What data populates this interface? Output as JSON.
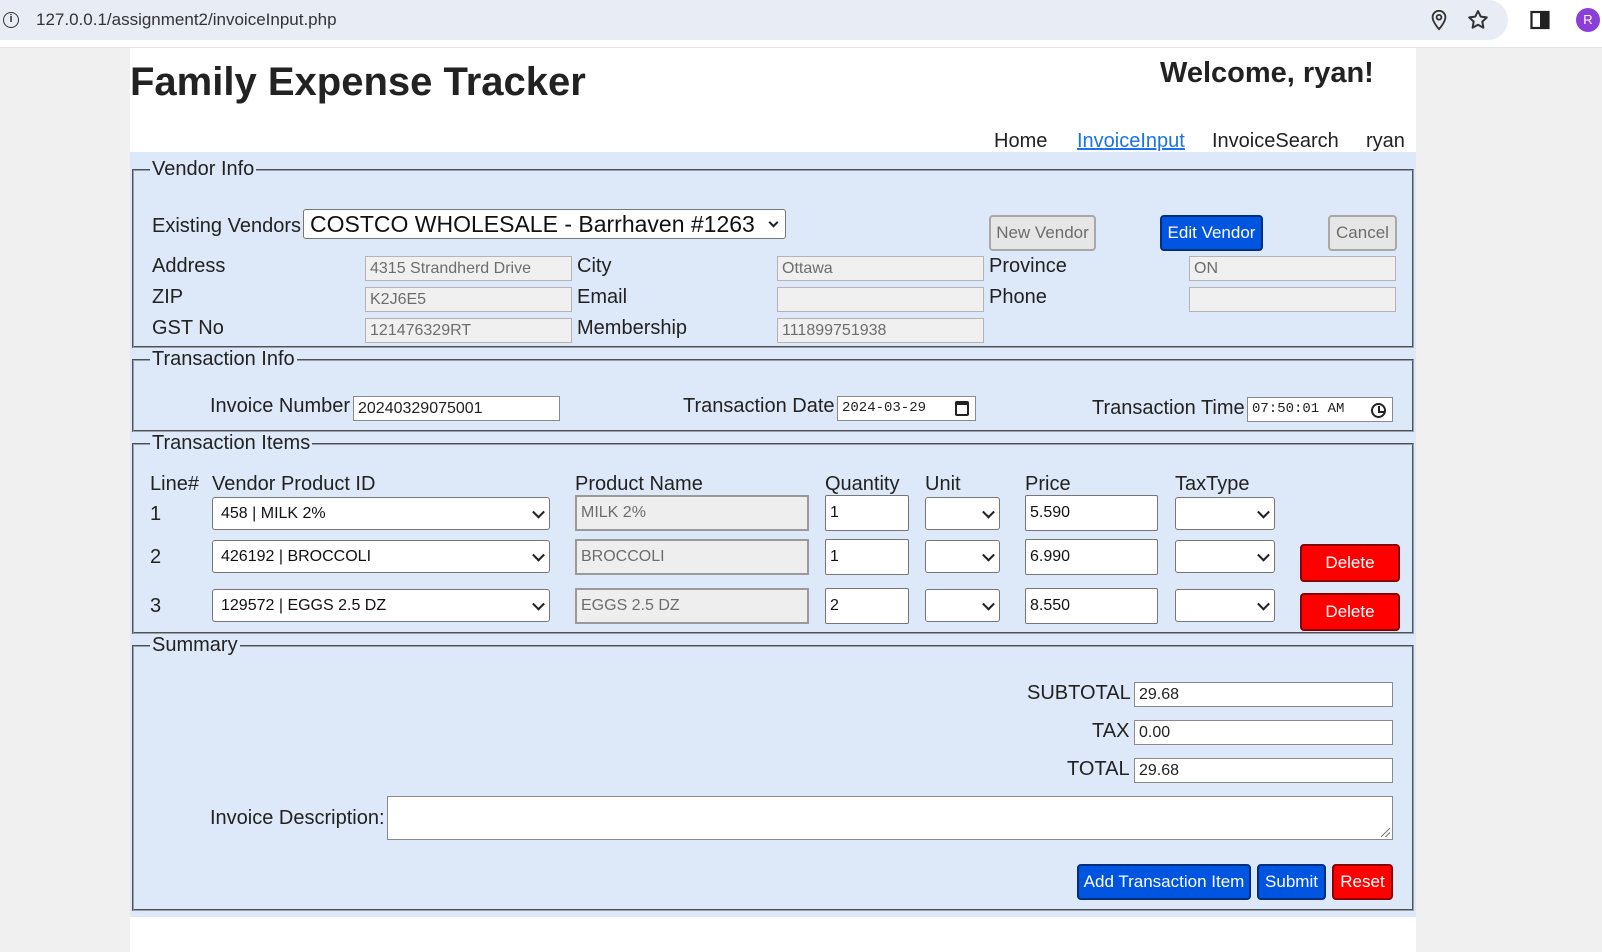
{
  "browser": {
    "url": "127.0.0.1/assignment2/invoiceInput.php",
    "profile_initial": "R"
  },
  "header": {
    "title": "Family Expense Tracker",
    "welcome": "Welcome, ryan!"
  },
  "nav": {
    "items": [
      {
        "label": "Home"
      },
      {
        "label": "InvoiceInput"
      },
      {
        "label": "InvoiceSearch"
      },
      {
        "label": "ryan"
      }
    ],
    "active": "InvoiceInput"
  },
  "vendor_info": {
    "legend": "Vendor Info",
    "existing_vendors_label": "Existing Vendors",
    "selected_vendor": "COSTCO WHOLESALE - Barrhaven #1263",
    "buttons": {
      "new_vendor": "New Vendor",
      "edit_vendor": "Edit Vendor",
      "cancel": "Cancel"
    },
    "fields": {
      "address": {
        "label": "Address",
        "value": "4315 Strandherd Drive"
      },
      "city": {
        "label": "City",
        "value": "Ottawa"
      },
      "province": {
        "label": "Province",
        "value": "ON"
      },
      "zip": {
        "label": "ZIP",
        "value": "K2J6E5"
      },
      "email": {
        "label": "Email",
        "value": ""
      },
      "phone": {
        "label": "Phone",
        "value": ""
      },
      "gst": {
        "label": "GST No",
        "value": "121476329RT"
      },
      "membership": {
        "label": "Membership",
        "value": "111899751938"
      }
    }
  },
  "transaction_info": {
    "legend": "Transaction Info",
    "invoice_number_label": "Invoice Number",
    "invoice_number": "20240329075001",
    "date_label": "Transaction Date",
    "date": "2024-03-29",
    "time_label": "Transaction Time",
    "time": "07:50:01 AM"
  },
  "transaction_items": {
    "legend": "Transaction Items",
    "headers": {
      "line": "Line#",
      "vendor_product_id": "Vendor Product ID",
      "product_name": "Product Name",
      "quantity": "Quantity",
      "unit": "Unit",
      "price": "Price",
      "taxtype": "TaxType"
    },
    "rows": [
      {
        "line": "1",
        "product_id": "458 | MILK 2%",
        "product_name": "MILK 2%",
        "quantity": "1",
        "unit": "",
        "price": "5.590",
        "taxtype": "",
        "delete": ""
      },
      {
        "line": "2",
        "product_id": "426192 | BROCCOLI",
        "product_name": "BROCCOLI",
        "quantity": "1",
        "unit": "",
        "price": "6.990",
        "taxtype": "",
        "delete": "Delete"
      },
      {
        "line": "3",
        "product_id": "129572 | EGGS 2.5 DZ",
        "product_name": "EGGS 2.5 DZ",
        "quantity": "2",
        "unit": "",
        "price": "8.550",
        "taxtype": "",
        "delete": "Delete"
      }
    ]
  },
  "summary": {
    "legend": "Summary",
    "subtotal_label": "SUBTOTAL",
    "subtotal": "29.68",
    "tax_label": "TAX",
    "tax": "0.00",
    "total_label": "TOTAL",
    "total": "29.68",
    "description_label": "Invoice Description:",
    "description": "",
    "buttons": {
      "add_item": "Add Transaction Item",
      "submit": "Submit",
      "reset": "Reset"
    }
  }
}
